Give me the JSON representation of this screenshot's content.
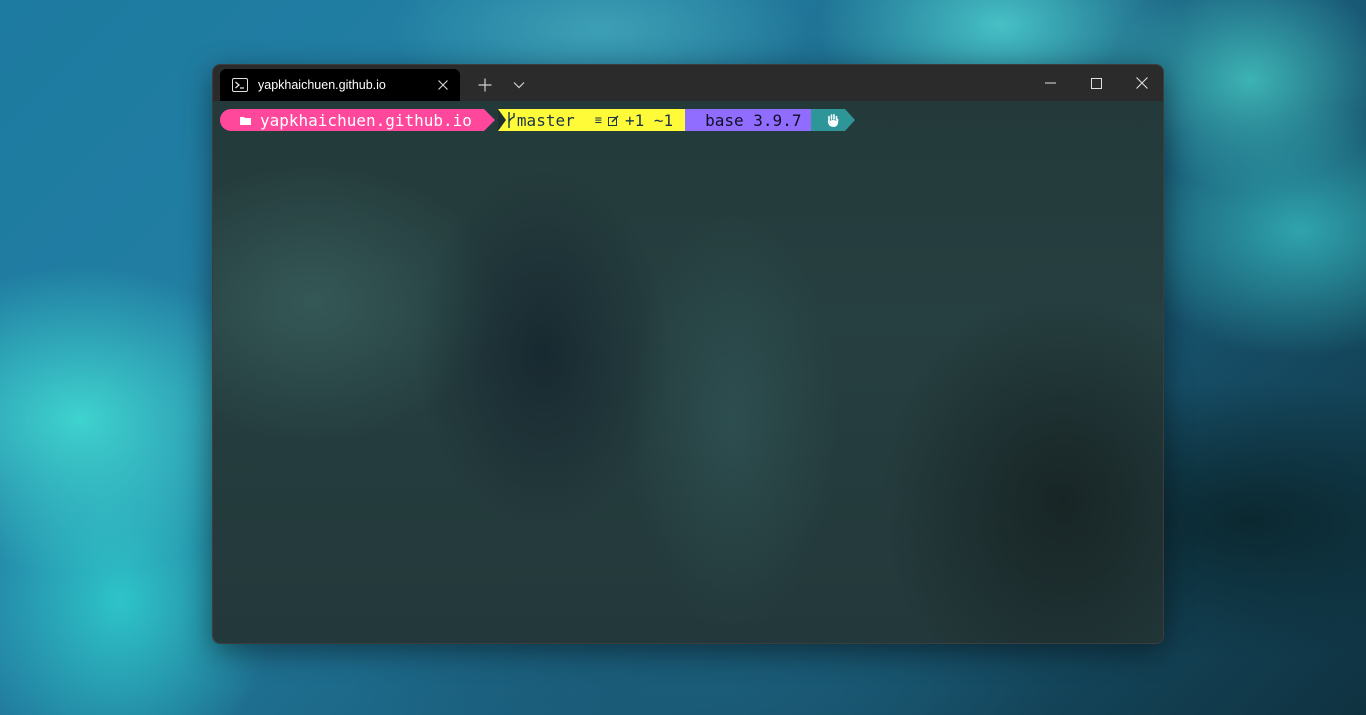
{
  "tab": {
    "title": "yapkhaichuen.github.io",
    "icon": "powershell-icon"
  },
  "prompt": {
    "path": "yapkhaichuen.github.io",
    "git_branch": "master",
    "git_status_glyph": "≡",
    "git_changes": "+1 ~1",
    "python_env": "base 3.9.7",
    "path_color": "#ff479c",
    "git_color": "#fffb38",
    "python_color": "#906cff",
    "end_color": "#2e9599"
  }
}
